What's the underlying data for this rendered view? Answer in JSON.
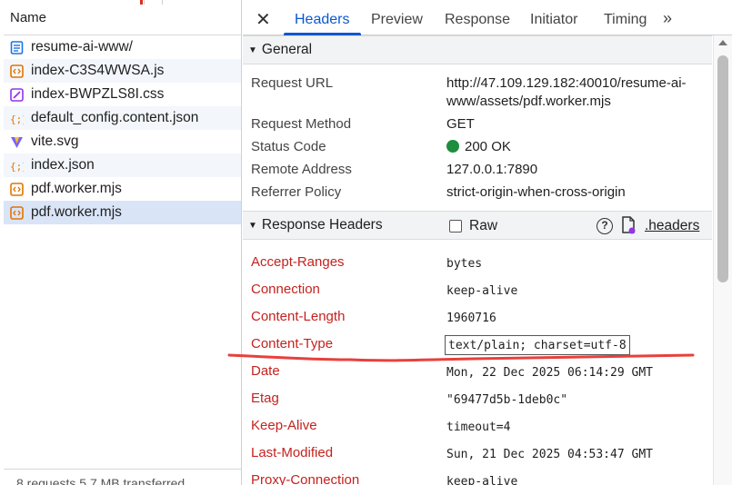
{
  "list": {
    "header": "Name",
    "files": [
      {
        "name": "resume-ai-www/",
        "icon": "document-icon",
        "color": "#1a73e8"
      },
      {
        "name": "index-C3S4WWSA.js",
        "icon": "script-icon",
        "color": "#e37400"
      },
      {
        "name": "index-BWPZLS8I.css",
        "icon": "stylesheet-icon",
        "color": "#9334e6"
      },
      {
        "name": "default_config.content.json",
        "icon": "json-icon",
        "color": "#e37400"
      },
      {
        "name": "vite.svg",
        "icon": "vite-icon",
        "color": "#7b61ff"
      },
      {
        "name": "index.json",
        "icon": "json-icon",
        "color": "#e37400"
      },
      {
        "name": "pdf.worker.mjs",
        "icon": "script-icon",
        "color": "#e37400"
      },
      {
        "name": "pdf.worker.mjs",
        "icon": "script-icon",
        "color": "#e37400"
      }
    ],
    "footer": "8 requests    5.7 MB transferred"
  },
  "tabs": {
    "close": "✕",
    "items": [
      "Headers",
      "Preview",
      "Response",
      "Initiator",
      "Timing"
    ],
    "more": "»",
    "active_color": "#0b57d0"
  },
  "general": {
    "title": "General",
    "request_url_label": "Request URL",
    "request_url_line1": "http://47.109.129.182:40010/resume-ai-",
    "request_url_line2": "www/assets/pdf.worker.mjs",
    "request_method_label": "Request Method",
    "request_method": "GET",
    "status_code_label": "Status Code",
    "status_code": "200 OK",
    "status_color": "#1e8e3e",
    "remote_address_label": "Remote Address",
    "remote_address": "127.0.0.1:7890",
    "referrer_policy_label": "Referrer Policy",
    "referrer_policy": "strict-origin-when-cross-origin"
  },
  "response_headers": {
    "title": "Response Headers",
    "raw_label": "Raw",
    "help": "?",
    "headers_link": ".headers",
    "header_name_color": "#c5221f",
    "rows": [
      {
        "name": "Accept-Ranges",
        "value": "bytes"
      },
      {
        "name": "Connection",
        "value": "keep-alive"
      },
      {
        "name": "Content-Length",
        "value": "1960716"
      },
      {
        "name": "Content-Type",
        "value": "text/plain; charset=utf-8"
      },
      {
        "name": "Date",
        "value": "Mon, 22 Dec 2025 06:14:29 GMT"
      },
      {
        "name": "Etag",
        "value": "\"69477d5b-1deb0c\""
      },
      {
        "name": "Keep-Alive",
        "value": "timeout=4"
      },
      {
        "name": "Last-Modified",
        "value": "Sun, 21 Dec 2025 04:53:47 GMT"
      },
      {
        "name": "Proxy-Connection",
        "value": "keep-alive"
      }
    ]
  },
  "annotation": {
    "color": "#e8403c"
  }
}
